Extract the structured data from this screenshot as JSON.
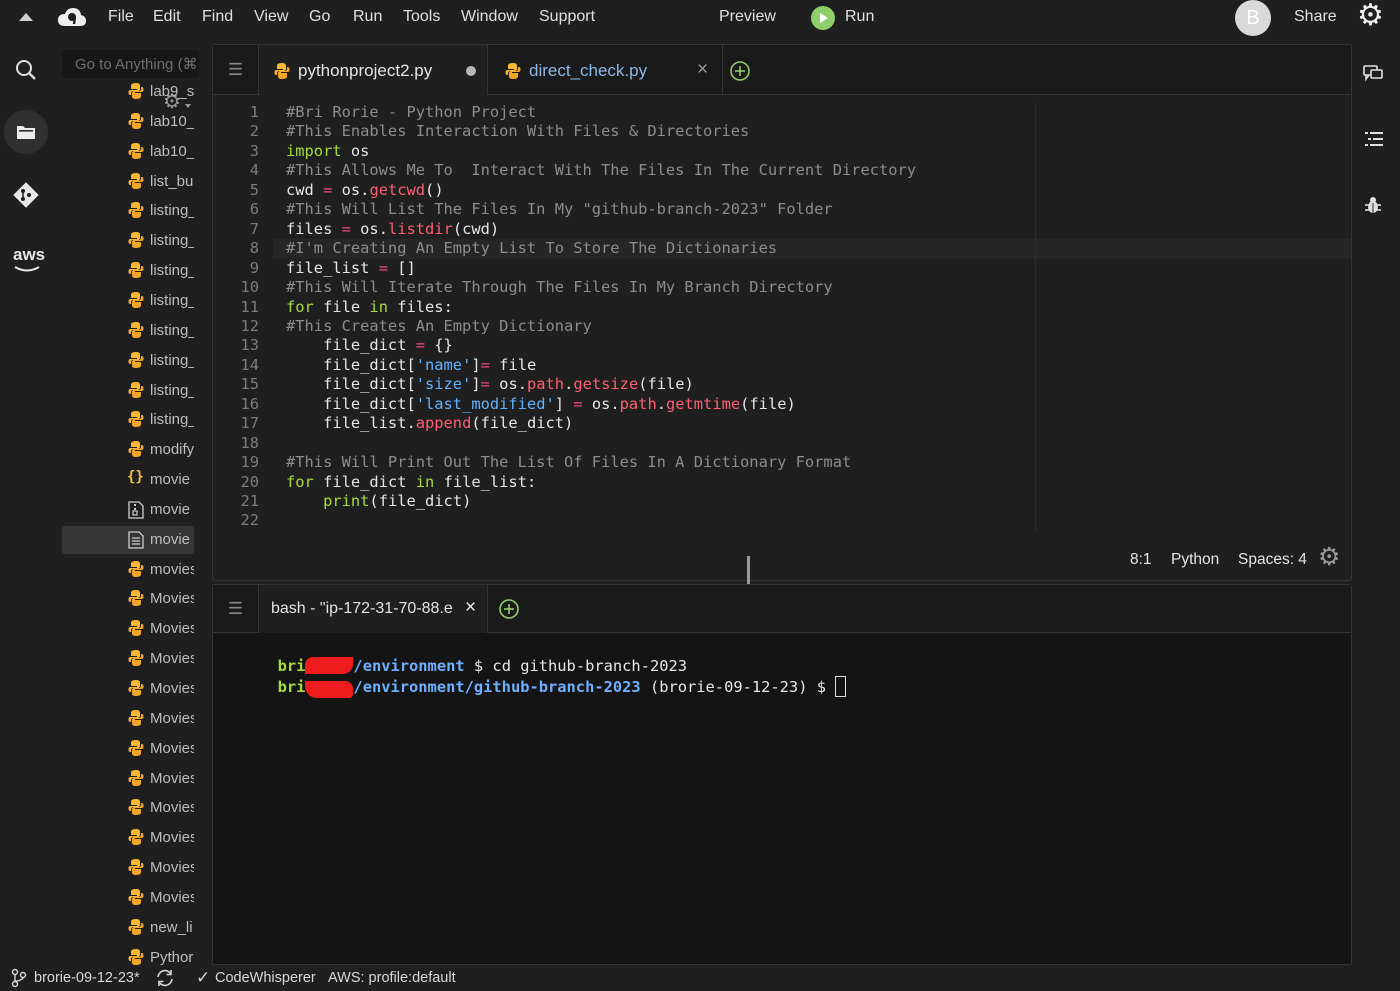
{
  "app": {
    "accent": "#a6db3c",
    "background": "#1f1f1f"
  },
  "menubar": {
    "items": [
      "File",
      "Edit",
      "Find",
      "View",
      "Go",
      "Run",
      "Tools",
      "Window",
      "Support"
    ],
    "preview_label": "Preview",
    "run_label": "Run",
    "avatar_letter": "B",
    "share_label": "Share"
  },
  "sidebar": {
    "aws_label": "aws"
  },
  "file_tree": {
    "goto_placeholder": "Go to Anything (⌘",
    "items": [
      {
        "label": "lab9_s",
        "icon": "python-file-icon"
      },
      {
        "label": "lab10_",
        "icon": "python-file-icon"
      },
      {
        "label": "lab10_",
        "icon": "python-file-icon"
      },
      {
        "label": "list_bu",
        "icon": "python-file-icon"
      },
      {
        "label": "listing_",
        "icon": "python-file-icon"
      },
      {
        "label": "listing_",
        "icon": "python-file-icon"
      },
      {
        "label": "listing_",
        "icon": "python-file-icon"
      },
      {
        "label": "listing_",
        "icon": "python-file-icon"
      },
      {
        "label": "listing_",
        "icon": "python-file-icon"
      },
      {
        "label": "listing_",
        "icon": "python-file-icon"
      },
      {
        "label": "listing_",
        "icon": "python-file-icon"
      },
      {
        "label": "listing_",
        "icon": "python-file-icon"
      },
      {
        "label": "modify",
        "icon": "python-file-icon"
      },
      {
        "label": "movie",
        "icon": "json-file-icon"
      },
      {
        "label": "movie",
        "icon": "zip-file-icon"
      },
      {
        "label": "movie",
        "icon": "text-file-icon",
        "selected": true
      },
      {
        "label": "movies",
        "icon": "python-file-icon"
      },
      {
        "label": "Movies",
        "icon": "python-file-icon"
      },
      {
        "label": "Movies",
        "icon": "python-file-icon"
      },
      {
        "label": "Movies",
        "icon": "python-file-icon"
      },
      {
        "label": "Movies",
        "icon": "python-file-icon"
      },
      {
        "label": "Movies",
        "icon": "python-file-icon"
      },
      {
        "label": "Movies",
        "icon": "python-file-icon"
      },
      {
        "label": "Movies",
        "icon": "python-file-icon"
      },
      {
        "label": "Movies",
        "icon": "python-file-icon"
      },
      {
        "label": "Movies",
        "icon": "python-file-icon"
      },
      {
        "label": "Movies",
        "icon": "python-file-icon"
      },
      {
        "label": "Movies",
        "icon": "python-file-icon"
      },
      {
        "label": "new_li",
        "icon": "python-file-icon"
      },
      {
        "label": "Pythor",
        "icon": "python-file-icon"
      }
    ]
  },
  "editor": {
    "tabs": [
      {
        "label": "pythonproject2.py",
        "active": true,
        "unsaved": true
      },
      {
        "label": "direct_check.py",
        "active": false,
        "close": "×"
      }
    ],
    "current_line": 8,
    "code": [
      [
        [
          "c",
          "#Bri Rorie - Python Project"
        ]
      ],
      [
        [
          "c",
          "#This Enables Interaction With Files & Directories"
        ]
      ],
      [
        [
          "k",
          "import"
        ],
        [
          "t",
          " os"
        ]
      ],
      [
        [
          "c",
          "#This Allows Me To  Interact With The Files In The Current Directory"
        ]
      ],
      [
        [
          "t",
          "cwd "
        ],
        [
          "o",
          "="
        ],
        [
          "t",
          " os."
        ],
        [
          "f",
          "getcwd"
        ],
        [
          "t",
          "()"
        ]
      ],
      [
        [
          "c",
          "#This Will List The Files In My \"github-branch-2023\" Folder"
        ]
      ],
      [
        [
          "t",
          "files "
        ],
        [
          "o",
          "="
        ],
        [
          "t",
          " os."
        ],
        [
          "f",
          "listdir"
        ],
        [
          "t",
          "(cwd)"
        ]
      ],
      [
        [
          "c",
          "#I'm Creating An Empty List To Store The Dictionaries"
        ]
      ],
      [
        [
          "t",
          "file_list "
        ],
        [
          "o",
          "="
        ],
        [
          "t",
          " []"
        ]
      ],
      [
        [
          "c",
          "#This Will Iterate Through The Files In My Branch Directory"
        ]
      ],
      [
        [
          "k",
          "for"
        ],
        [
          "t",
          " file "
        ],
        [
          "k",
          "in"
        ],
        [
          "t",
          " files:"
        ]
      ],
      [
        [
          "c",
          "#This Creates An Empty Dictionary"
        ]
      ],
      [
        [
          "t",
          "    file_dict "
        ],
        [
          "o",
          "="
        ],
        [
          "t",
          " {}"
        ]
      ],
      [
        [
          "t",
          "    file_dict["
        ],
        [
          "s",
          "'name'"
        ],
        [
          "t",
          "]"
        ],
        [
          "o",
          "="
        ],
        [
          "t",
          " file"
        ]
      ],
      [
        [
          "t",
          "    file_dict["
        ],
        [
          "s",
          "'size'"
        ],
        [
          "t",
          "]"
        ],
        [
          "o",
          "="
        ],
        [
          "t",
          " os."
        ],
        [
          "f",
          "path"
        ],
        [
          "t",
          "."
        ],
        [
          "f",
          "getsize"
        ],
        [
          "t",
          "(file)"
        ]
      ],
      [
        [
          "t",
          "    file_dict["
        ],
        [
          "s",
          "'last_modified'"
        ],
        [
          "t",
          "] "
        ],
        [
          "o",
          "="
        ],
        [
          "t",
          " os."
        ],
        [
          "f",
          "path"
        ],
        [
          "t",
          "."
        ],
        [
          "f",
          "getmtime"
        ],
        [
          "t",
          "(file)"
        ]
      ],
      [
        [
          "t",
          "    file_list."
        ],
        [
          "f",
          "append"
        ],
        [
          "t",
          "(file_dict)"
        ]
      ],
      [
        [
          "t",
          ""
        ]
      ],
      [
        [
          "c",
          "#This Will Print Out The List Of Files In A Dictionary Format"
        ]
      ],
      [
        [
          "k",
          "for"
        ],
        [
          "t",
          " file_dict "
        ],
        [
          "k",
          "in"
        ],
        [
          "t",
          " file_list:"
        ]
      ],
      [
        [
          "t",
          "    "
        ],
        [
          "k",
          "print"
        ],
        [
          "t",
          "(file_dict)"
        ]
      ],
      [
        [
          "t",
          ""
        ]
      ]
    ],
    "status": {
      "position": "8:1",
      "language": "Python",
      "spaces": "Spaces: 4"
    }
  },
  "terminal": {
    "tab_label": "bash - \"ip-172-31-70-88.e",
    "tab_close": "×",
    "lines": [
      {
        "user": "bri",
        "path": "/environment",
        "rest": " $ cd github-branch-2023"
      },
      {
        "user": "bri",
        "path": "/environment/github-branch-2023",
        "rest": " (brorie-09-12-23) $ "
      }
    ]
  },
  "statusbar": {
    "branch": "brorie-09-12-23*",
    "codewhisperer": "CodeWhisperer",
    "aws_profile": "AWS: profile:default"
  }
}
